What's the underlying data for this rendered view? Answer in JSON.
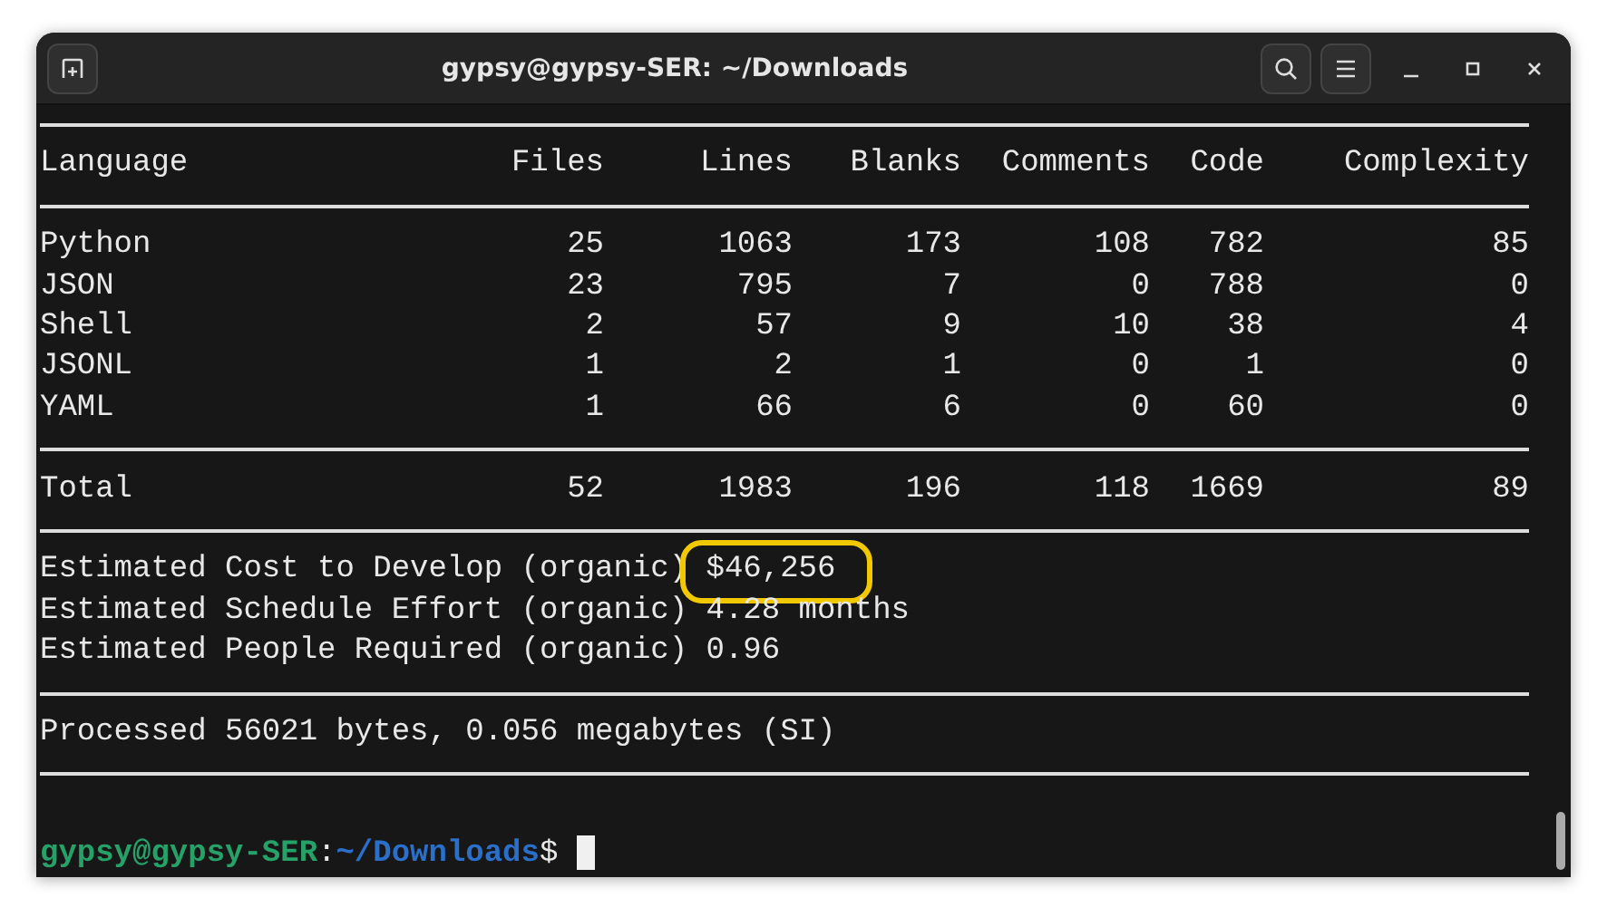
{
  "window": {
    "title": "gypsy@gypsy-SER: ~/Downloads"
  },
  "table": {
    "columns": [
      "Language",
      "Files",
      "Lines",
      "Blanks",
      "Comments",
      "Code",
      "Complexity"
    ],
    "rows": [
      [
        "Python",
        "25",
        "1063",
        "173",
        "108",
        "782",
        "85"
      ],
      [
        "JSON",
        "23",
        "795",
        "7",
        "0",
        "788",
        "0"
      ],
      [
        "Shell",
        "2",
        "57",
        "9",
        "10",
        "38",
        "4"
      ],
      [
        "JSONL",
        "1",
        "2",
        "1",
        "0",
        "1",
        "0"
      ],
      [
        "YAML",
        "1",
        "66",
        "6",
        "0",
        "60",
        "0"
      ]
    ],
    "total": [
      "Total",
      "52",
      "1983",
      "196",
      "118",
      "1669",
      "89"
    ]
  },
  "estimates": [
    {
      "label": "Estimated Cost to Develop (organic)",
      "value": "$46,256",
      "highlighted": true
    },
    {
      "label": "Estimated Schedule Effort (organic)",
      "value": "4.28 months",
      "highlighted": false
    },
    {
      "label": "Estimated People Required (organic)",
      "value": "0.96",
      "highlighted": false
    }
  ],
  "processed": "Processed 56021 bytes, 0.056 megabytes (SI)",
  "prompt": {
    "user": "gypsy@gypsy-SER",
    "separator": ":",
    "path": "~/Downloads",
    "symbol": "$"
  }
}
